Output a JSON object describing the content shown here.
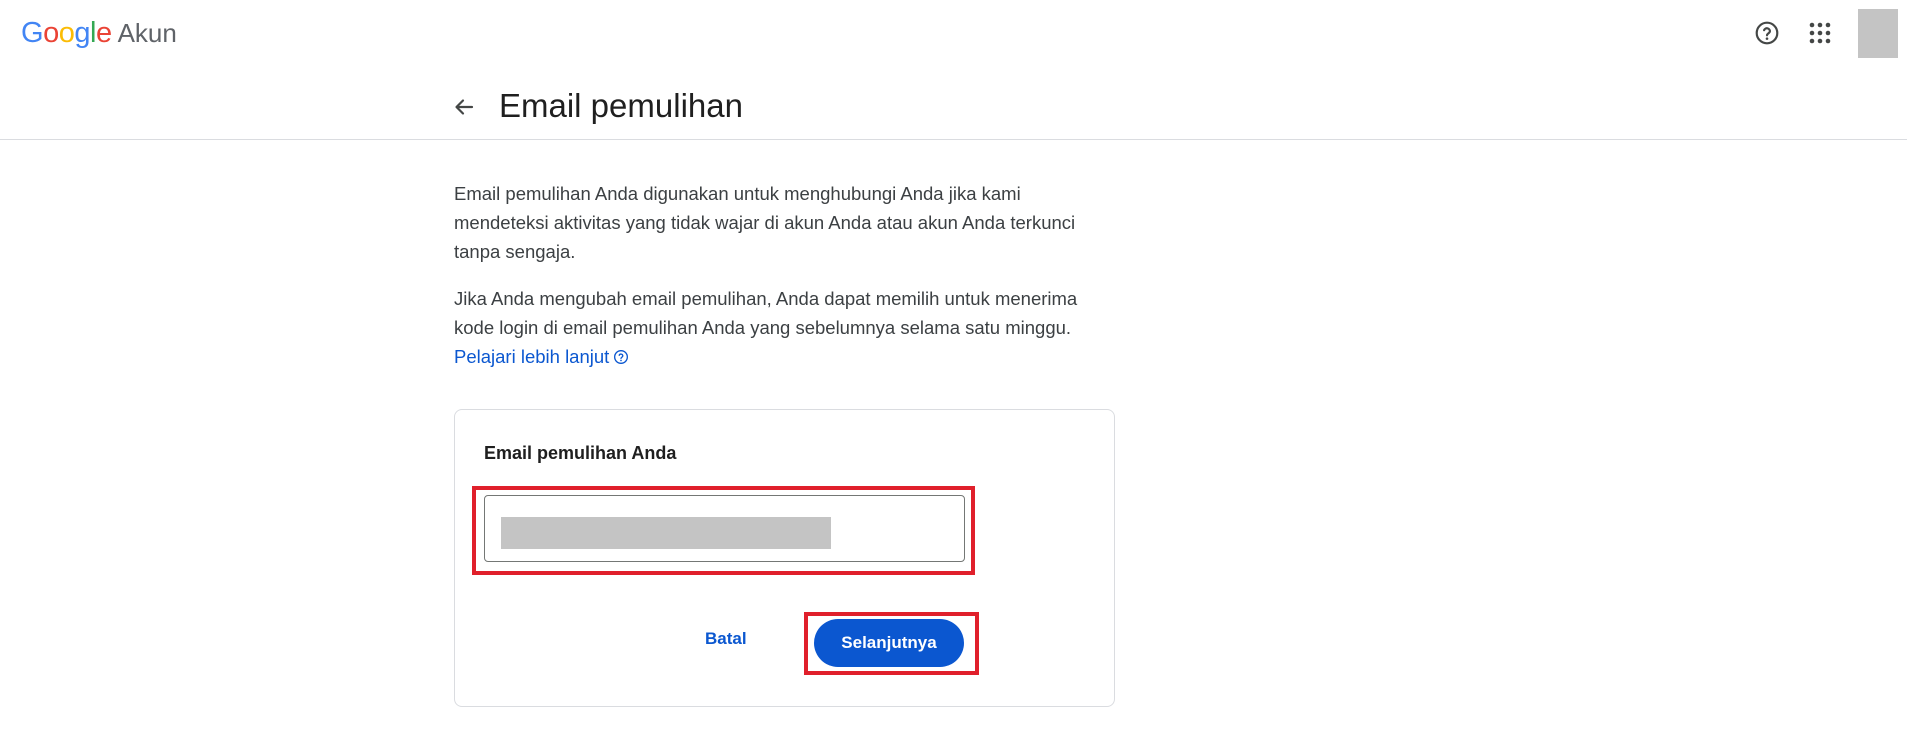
{
  "header": {
    "logo_google": "Google",
    "logo_product": "Akun",
    "help_icon": "help-circle-icon",
    "apps_icon": "apps-grid-icon"
  },
  "page": {
    "title": "Email pemulihan",
    "description_1": "Email pemulihan Anda digunakan untuk menghubungi Anda jika kami mendeteksi aktivitas yang tidak wajar di akun Anda atau akun Anda terkunci tanpa sengaja.",
    "description_2": "Jika Anda mengubah email pemulihan, Anda dapat memilih untuk menerima kode login di email pemulihan Anda yang sebelumnya selama satu minggu.",
    "learn_more": "Pelajari lebih lanjut"
  },
  "card": {
    "label": "Email pemulihan Anda",
    "cancel_label": "Batal",
    "next_label": "Selanjutnya"
  },
  "colors": {
    "accent": "#0b57d0",
    "highlight": "#e0202b",
    "redaction": "#c4c4c4"
  }
}
